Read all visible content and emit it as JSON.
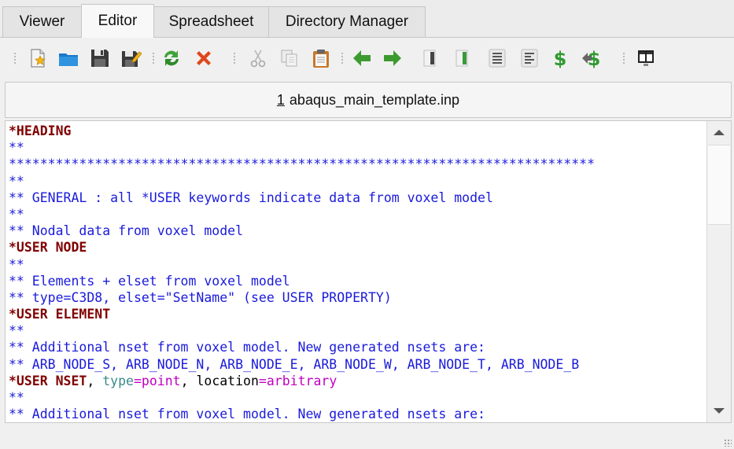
{
  "tabs": [
    {
      "label": "Viewer",
      "active": false
    },
    {
      "label": "Editor",
      "active": true
    },
    {
      "label": "Spreadsheet",
      "active": false
    },
    {
      "label": "Directory Manager",
      "active": false
    }
  ],
  "toolbar": {
    "icons": [
      "new-file-icon",
      "open-folder-icon",
      "save-icon",
      "save-as-icon",
      "reload-icon",
      "close-icon",
      "cut-icon",
      "copy-icon",
      "paste-icon",
      "arrow-left-icon",
      "arrow-right-icon",
      "indent-left-icon",
      "indent-right-icon",
      "align-justify-icon",
      "align-left-icon",
      "dollar-icon",
      "dollar-arrow-icon",
      "split-view-icon"
    ]
  },
  "file": {
    "index": "1",
    "name": "abaqus_main_template.inp"
  },
  "code_lines": [
    [
      {
        "t": "*HEADING",
        "c": "kw"
      }
    ],
    [
      {
        "t": "**",
        "c": "cm"
      }
    ],
    [
      {
        "t": "***************************************************************************",
        "c": "cm"
      }
    ],
    [
      {
        "t": "**",
        "c": "cm"
      }
    ],
    [
      {
        "t": "** GENERAL : all *USER keywords indicate data from voxel model",
        "c": "cm"
      }
    ],
    [
      {
        "t": "**",
        "c": "cm"
      }
    ],
    [
      {
        "t": "** Nodal data from voxel model",
        "c": "cm"
      }
    ],
    [
      {
        "t": "*USER NODE",
        "c": "kw"
      }
    ],
    [
      {
        "t": "**",
        "c": "cm"
      }
    ],
    [
      {
        "t": "** Elements + elset from voxel model",
        "c": "cm"
      }
    ],
    [
      {
        "t": "** type=C3D8, elset=\"SetName\" (see USER PROPERTY)",
        "c": "cm"
      }
    ],
    [
      {
        "t": "*USER ELEMENT",
        "c": "kw"
      }
    ],
    [
      {
        "t": "**",
        "c": "cm"
      }
    ],
    [
      {
        "t": "** Additional nset from voxel model. New generated nsets are:",
        "c": "cm"
      }
    ],
    [
      {
        "t": "** ARB_NODE_S, ARB_NODE_N, ARB_NODE_E, ARB_NODE_W, ARB_NODE_T, ARB_NODE_B",
        "c": "cm"
      }
    ],
    [
      {
        "t": "*USER NSET",
        "c": "kw"
      },
      {
        "t": ", ",
        "c": "tx"
      },
      {
        "t": "type",
        "c": "pn"
      },
      {
        "t": "=point",
        "c": "pv"
      },
      {
        "t": ", location",
        "c": "tx"
      },
      {
        "t": "=arbitrary",
        "c": "pv"
      }
    ],
    [
      {
        "t": "**",
        "c": "cm"
      }
    ],
    [
      {
        "t": "** Additional nset from voxel model. New generated nsets are:",
        "c": "cm"
      }
    ]
  ],
  "colors": {
    "keyword": "#800000",
    "comment": "#1a1adb",
    "param_name": "#3a8a8a",
    "param_value": "#c000c0"
  }
}
